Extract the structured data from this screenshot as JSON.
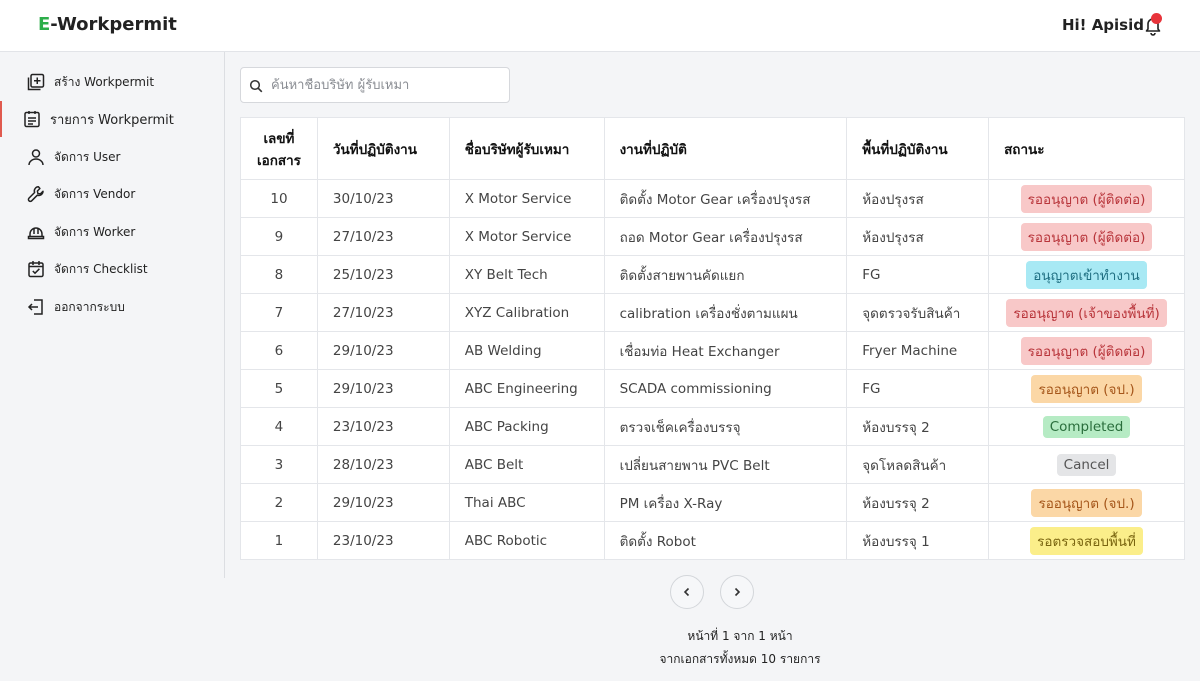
{
  "header": {
    "brand_prefix": "E",
    "brand_rest": "-Workpermit",
    "greeting": "Hi! Apisid"
  },
  "sidebar": {
    "items": [
      {
        "label": "สร้าง Workpermit",
        "icon": "add-square-icon"
      },
      {
        "label": "รายการ Workpermit",
        "icon": "list-clipboard-icon",
        "active": true
      },
      {
        "label": "จัดการ User",
        "icon": "user-icon"
      },
      {
        "label": "จัดการ Vendor",
        "icon": "wrench-icon"
      },
      {
        "label": "จัดการ Worker",
        "icon": "helmet-icon"
      },
      {
        "label": "จัดการ Checklist",
        "icon": "calendar-check-icon"
      },
      {
        "label": "ออกจากระบบ",
        "icon": "logout-icon"
      }
    ]
  },
  "search": {
    "placeholder": "ค้นหาชื่อบริษัท ผู้รับเหมา"
  },
  "table": {
    "headers": [
      "เลขที่\nเอกสาร",
      "วันที่ปฏิบัติงาน",
      "ชื่อบริษัทผู้รับเหมา",
      "งานที่ปฏิบัติ",
      "พื้นที่ปฏิบัติงาน",
      "สถานะ"
    ],
    "rows": [
      {
        "no": "10",
        "date": "30/10/23",
        "company": "X Motor Service",
        "task": "ติดตั้ง Motor Gear เครื่องปรุงรส",
        "area": "ห้องปรุงรส",
        "status": "รออนุญาต (ผู้ติดต่อ)",
        "tone": "red"
      },
      {
        "no": "9",
        "date": "27/10/23",
        "company": "X Motor Service",
        "task": "ถอด Motor Gear เครื่องปรุงรส",
        "area": "ห้องปรุงรส",
        "status": "รออนุญาต (ผู้ติดต่อ)",
        "tone": "red"
      },
      {
        "no": "8",
        "date": "25/10/23",
        "company": "XY Belt Tech",
        "task": "ติดตั้งสายพานคัดแยก",
        "area": "FG",
        "status": "อนุญาตเข้าทำงาน",
        "tone": "cyan"
      },
      {
        "no": "7",
        "date": "27/10/23",
        "company": "XYZ Calibration",
        "task": "calibration เครื่องชั่งตามแผน",
        "area": "จุดตรวจรับสินค้า",
        "status": "รออนุญาต (เจ้าของพื้นที่)",
        "tone": "red"
      },
      {
        "no": "6",
        "date": "29/10/23",
        "company": "AB Welding",
        "task": "เชื่อมท่อ Heat Exchanger",
        "area": "Fryer Machine",
        "status": "รออนุญาต (ผู้ติดต่อ)",
        "tone": "red"
      },
      {
        "no": "5",
        "date": "29/10/23",
        "company": "ABC Engineering",
        "task": "SCADA commissioning",
        "area": "FG",
        "status": "รออนุญาต (จป.)",
        "tone": "orange"
      },
      {
        "no": "4",
        "date": "23/10/23",
        "company": "ABC Packing",
        "task": "ตรวจเช็คเครื่องบรรจุ",
        "area": "ห้องบรรจุ 2",
        "status": "Completed",
        "tone": "green"
      },
      {
        "no": "3",
        "date": "28/10/23",
        "company": "ABC Belt",
        "task": "เปลี่ยนสายพาน PVC Belt",
        "area": "จุดโหลดสินค้า",
        "status": "Cancel",
        "tone": "gray"
      },
      {
        "no": "2",
        "date": "29/10/23",
        "company": "Thai ABC",
        "task": "PM เครื่อง X-Ray",
        "area": "ห้องบรรจุ 2",
        "status": "รออนุญาต (จป.)",
        "tone": "orange"
      },
      {
        "no": "1",
        "date": "23/10/23",
        "company": "ABC Robotic",
        "task": "ติดตั้ง Robot",
        "area": "ห้องบรรจุ 1",
        "status": "รอตรวจสอบพื้นที่",
        "tone": "yellow"
      }
    ]
  },
  "badge_colors": {
    "red": {
      "bg": "#f8c8c8",
      "fg": "#b8343a"
    },
    "cyan": {
      "bg": "#a8e9f4",
      "fg": "#1f6f82"
    },
    "orange": {
      "bg": "#fbd7a6",
      "fg": "#a5561a"
    },
    "green": {
      "bg": "#b6ebc4",
      "fg": "#2a6e3c"
    },
    "gray": {
      "bg": "#e4e5e7",
      "fg": "#555555"
    },
    "yellow": {
      "bg": "#fbee8a",
      "fg": "#7a6510"
    }
  },
  "pagination": {
    "prev_icon": "chevron-left-icon",
    "next_icon": "chevron-right-icon",
    "page_text": "หน้าที่ 1 จาก 1 หน้า",
    "total_text": "จากเอกสารทั้งหมด 10 รายการ"
  }
}
